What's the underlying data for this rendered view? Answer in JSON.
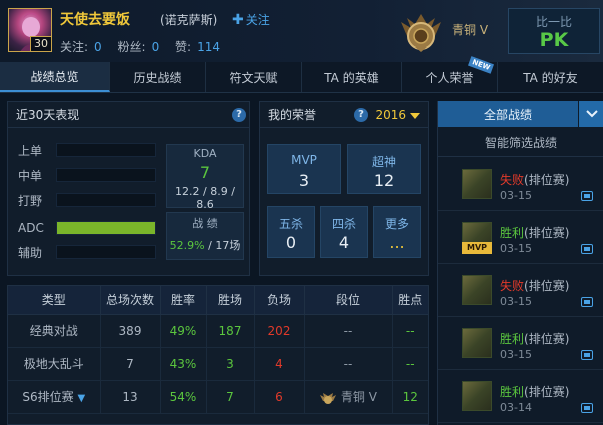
{
  "profile": {
    "name": "天使去要饭",
    "level": "30",
    "server": "(诺克萨斯)",
    "follow_label": "关注",
    "stats": [
      {
        "label": "关注:",
        "value": "0"
      },
      {
        "label": "粉丝:",
        "value": "0"
      },
      {
        "label": "赞:",
        "value": "114"
      }
    ],
    "rank": "青铜 V",
    "compare_label": "比一比",
    "pk_label": "PK"
  },
  "tabs": [
    {
      "label": "战绩总览",
      "active": true
    },
    {
      "label": "历史战绩"
    },
    {
      "label": "符文天赋"
    },
    {
      "label": "TA 的英雄"
    },
    {
      "label": "个人荣誉",
      "badge": "NEW"
    },
    {
      "label": "TA 的好友"
    }
  ],
  "recent": {
    "title": "近30天表现",
    "help": "?",
    "lanes": [
      {
        "label": "上单",
        "fill": 0
      },
      {
        "label": "中单",
        "fill": 0
      },
      {
        "label": "打野",
        "fill": 0
      },
      {
        "label": "ADC",
        "fill": 1.0
      },
      {
        "label": "辅助",
        "fill": 0
      }
    ],
    "kda_title": "KDA",
    "kda_value": "7",
    "kda_detail": "12.2 / 8.9 / 8.6",
    "record_title": "战 绩",
    "win_rate": "52.9%",
    "games": "17场"
  },
  "honor": {
    "title": "我的荣誉",
    "year": "2016",
    "items": [
      {
        "title": "MVP",
        "value": "3"
      },
      {
        "title": "超神",
        "value": "12"
      },
      {
        "title": "五杀",
        "value": "0"
      },
      {
        "title": "四杀",
        "value": "4"
      },
      {
        "title": "更多",
        "value": "..."
      }
    ]
  },
  "table": {
    "headers": [
      "类型",
      "总场次数",
      "胜率",
      "胜场",
      "负场",
      "段位",
      "胜点"
    ],
    "rows": [
      {
        "type": "经典对战",
        "total": "389",
        "rate": "49%",
        "win": "187",
        "lose": "202",
        "rank": "--",
        "points": "--"
      },
      {
        "type": "极地大乱斗",
        "total": "7",
        "rate": "43%",
        "win": "3",
        "lose": "4",
        "rank": "--",
        "points": "--"
      },
      {
        "type": "S6排位赛",
        "total": "13",
        "rate": "54%",
        "win": "7",
        "lose": "6",
        "rank": "青铜 V",
        "points": "12"
      }
    ]
  },
  "matches": {
    "all_label": "全部战绩",
    "filter_label": "智能筛选战绩",
    "items": [
      {
        "result": "失败",
        "mode": "(排位赛)",
        "date": "03-15",
        "win": false,
        "mvp": false
      },
      {
        "result": "胜利",
        "mode": "(排位赛)",
        "date": "03-15",
        "win": true,
        "mvp": true
      },
      {
        "result": "失败",
        "mode": "(排位赛)",
        "date": "03-15",
        "win": false,
        "mvp": false
      },
      {
        "result": "胜利",
        "mode": "(排位赛)",
        "date": "03-15",
        "win": true,
        "mvp": false
      },
      {
        "result": "胜利",
        "mode": "(排位赛)",
        "date": "03-14",
        "win": true,
        "mvp": false
      }
    ],
    "mvp_badge": "MVP"
  },
  "colors": {
    "win": "#5bc63e",
    "lose": "#e23a2a",
    "accent": "#4aa3e6",
    "gold": "#f0c83a"
  }
}
